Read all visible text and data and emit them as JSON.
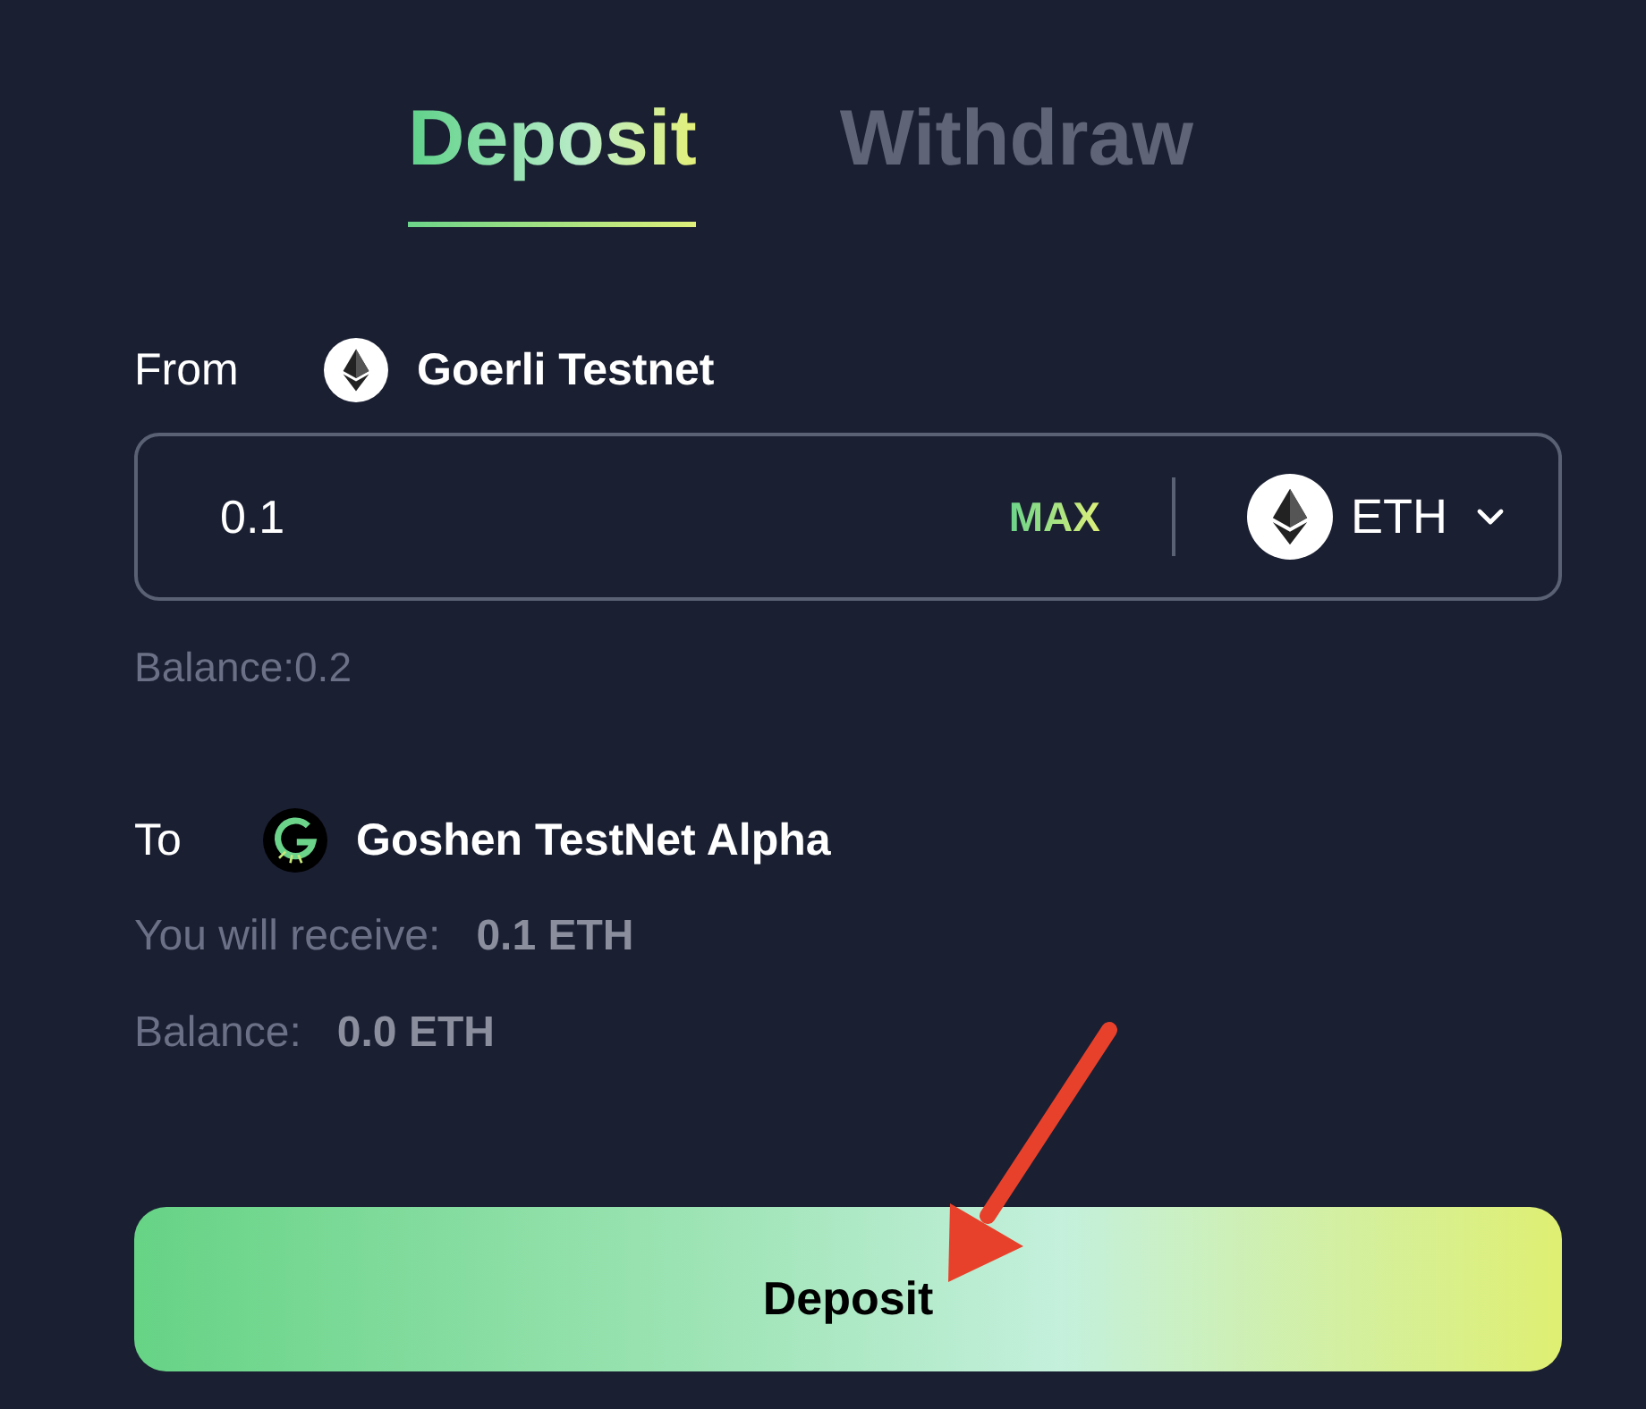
{
  "tabs": [
    {
      "label": "Deposit",
      "selected": true
    },
    {
      "label": "Withdraw",
      "selected": false
    }
  ],
  "from": {
    "label": "From",
    "network": "Goerli Testnet"
  },
  "amount": {
    "value": "0.1",
    "max_label": "MAX",
    "token": "ETH"
  },
  "from_balance": "Balance:0.2",
  "to": {
    "label": "To",
    "network": "Goshen TestNet Alpha"
  },
  "details": [
    {
      "label": "You will receive:",
      "value": "0.1 ETH"
    },
    {
      "label": "Balance:",
      "value": "0.0 ETH"
    }
  ],
  "submit": "Deposit"
}
